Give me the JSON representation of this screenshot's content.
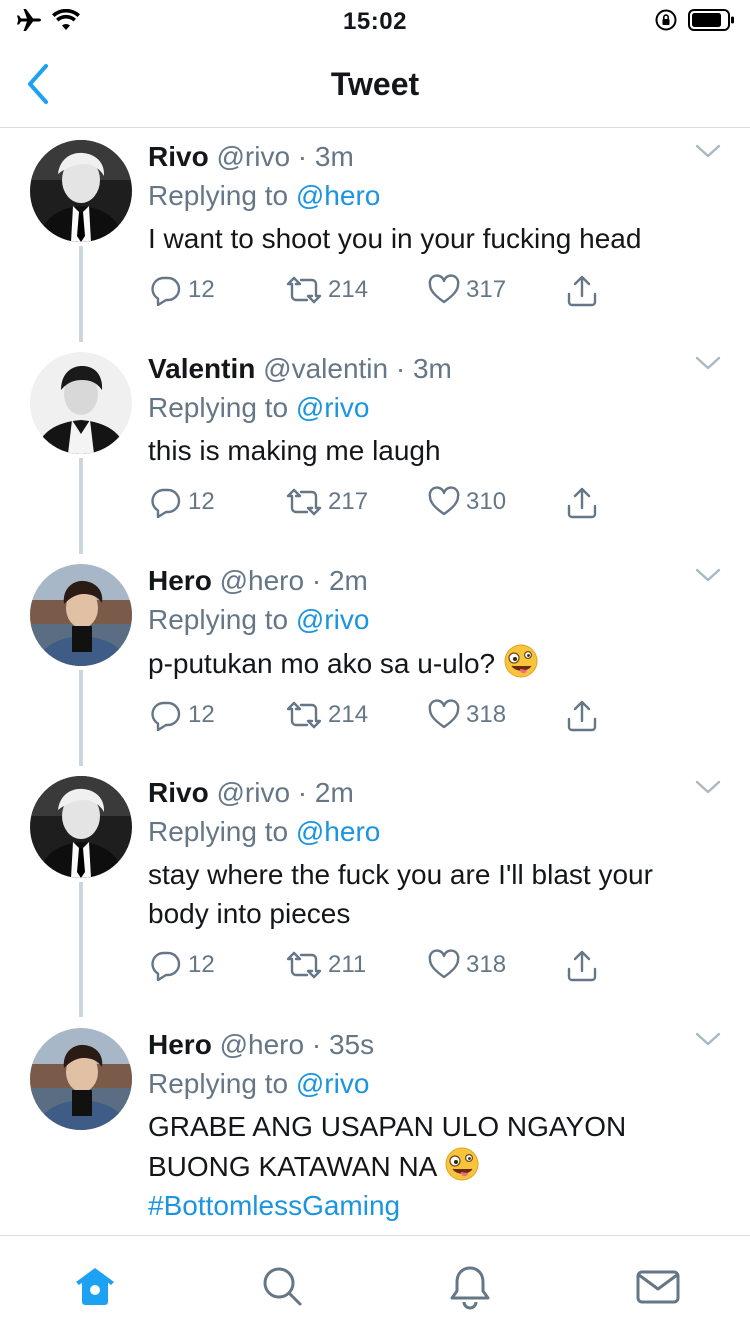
{
  "status": {
    "time": "15:02"
  },
  "nav": {
    "title": "Tweet"
  },
  "tweets": [
    {
      "name": "Rivo",
      "handle": "@rivo",
      "sep": "·",
      "time": "3m",
      "replying_label": "Replying to",
      "replying_to": "@hero",
      "text": "I want to shoot you in your fucking head",
      "replies": "12",
      "retweets": "214",
      "likes": "317"
    },
    {
      "name": "Valentin",
      "handle": "@valentin",
      "sep": "·",
      "time": "3m",
      "replying_label": "Replying to",
      "replying_to": "@rivo",
      "text": "this is making me laugh",
      "replies": "12",
      "retweets": "217",
      "likes": "310"
    },
    {
      "name": "Hero",
      "handle": "@hero",
      "sep": "·",
      "time": "2m",
      "replying_label": "Replying to",
      "replying_to": "@rivo",
      "text": "p-putukan mo ako sa u-ulo?",
      "replies": "12",
      "retweets": "214",
      "likes": "318"
    },
    {
      "name": "Rivo",
      "handle": "@rivo",
      "sep": "·",
      "time": "2m",
      "replying_label": "Replying to",
      "replying_to": "@hero",
      "text_line1": "stay where the fuck you are I'll blast your",
      "text_line2": "body into pieces",
      "replies": "12",
      "retweets": "211",
      "likes": "318"
    },
    {
      "name": "Hero",
      "handle": "@hero",
      "sep": "·",
      "time": "35s",
      "replying_label": "Replying to",
      "replying_to": "@rivo",
      "text_line1": "GRABE ANG USAPAN ULO NGAYON",
      "text_line2": "BUONG KATAWAN NA",
      "hashtag": "#BottomlessGaming"
    }
  ],
  "icons": {
    "airplane": "airplane-icon",
    "wifi": "wifi-icon",
    "rotation_lock": "rotation-lock-icon",
    "battery": "battery-icon",
    "back": "back-chevron-icon",
    "caret": "chevron-down-icon",
    "reply": "reply-icon",
    "retweet": "retweet-icon",
    "like": "heart-icon",
    "share": "share-icon",
    "emoji": "zany-face-emoji",
    "home": "home-icon",
    "search": "search-icon",
    "notifications": "bell-icon",
    "messages": "mail-icon"
  },
  "colors": {
    "accent": "#1da1f2",
    "link": "#1b95e0",
    "secondary_text": "#657786",
    "thread_line": "#ccd6dd",
    "divider": "#d8dce0"
  }
}
